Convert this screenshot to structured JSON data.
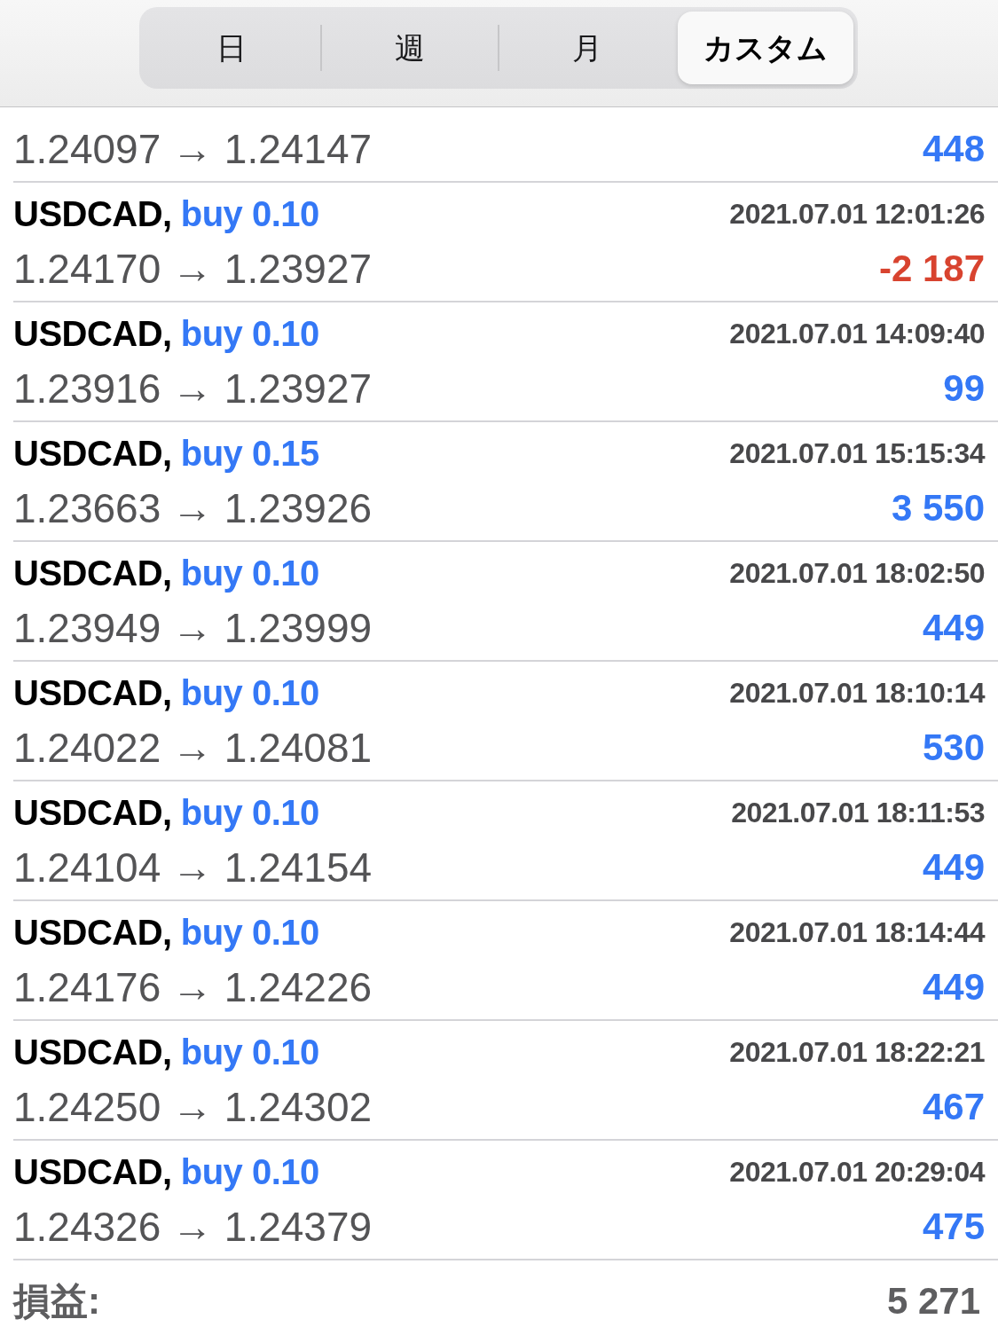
{
  "segments": [
    {
      "label": "日",
      "selected": false
    },
    {
      "label": "週",
      "selected": false
    },
    {
      "label": "月",
      "selected": false
    },
    {
      "label": "カスタム",
      "selected": true
    }
  ],
  "trades": [
    {
      "price": "1.24097 → 1.24147",
      "profit": "448",
      "color": "#3478f6"
    },
    {
      "symbol": "USDCAD,",
      "order": "buy 0.10",
      "time": "2021.07.01 12:01:26",
      "price": "1.24170 → 1.23927",
      "profit": "-2 187",
      "color": "#d8432f"
    },
    {
      "symbol": "USDCAD,",
      "order": "buy 0.10",
      "time": "2021.07.01 14:09:40",
      "price": "1.23916 → 1.23927",
      "profit": "99",
      "color": "#3478f6"
    },
    {
      "symbol": "USDCAD,",
      "order": "buy 0.15",
      "time": "2021.07.01 15:15:34",
      "price": "1.23663 → 1.23926",
      "profit": "3 550",
      "color": "#3478f6"
    },
    {
      "symbol": "USDCAD,",
      "order": "buy 0.10",
      "time": "2021.07.01 18:02:50",
      "price": "1.23949 → 1.23999",
      "profit": "449",
      "color": "#3478f6"
    },
    {
      "symbol": "USDCAD,",
      "order": "buy 0.10",
      "time": "2021.07.01 18:10:14",
      "price": "1.24022 → 1.24081",
      "profit": "530",
      "color": "#3478f6"
    },
    {
      "symbol": "USDCAD,",
      "order": "buy 0.10",
      "time": "2021.07.01 18:11:53",
      "price": "1.24104 → 1.24154",
      "profit": "449",
      "color": "#3478f6"
    },
    {
      "symbol": "USDCAD,",
      "order": "buy 0.10",
      "time": "2021.07.01 18:14:44",
      "price": "1.24176 → 1.24226",
      "profit": "449",
      "color": "#3478f6"
    },
    {
      "symbol": "USDCAD,",
      "order": "buy 0.10",
      "time": "2021.07.01 18:22:21",
      "price": "1.24250 → 1.24302",
      "profit": "467",
      "color": "#3478f6"
    },
    {
      "symbol": "USDCAD,",
      "order": "buy 0.10",
      "time": "2021.07.01 20:29:04",
      "price": "1.24326 → 1.24379",
      "profit": "475",
      "color": "#3478f6"
    }
  ],
  "summary": {
    "label": "損益:",
    "value": "5 271"
  }
}
